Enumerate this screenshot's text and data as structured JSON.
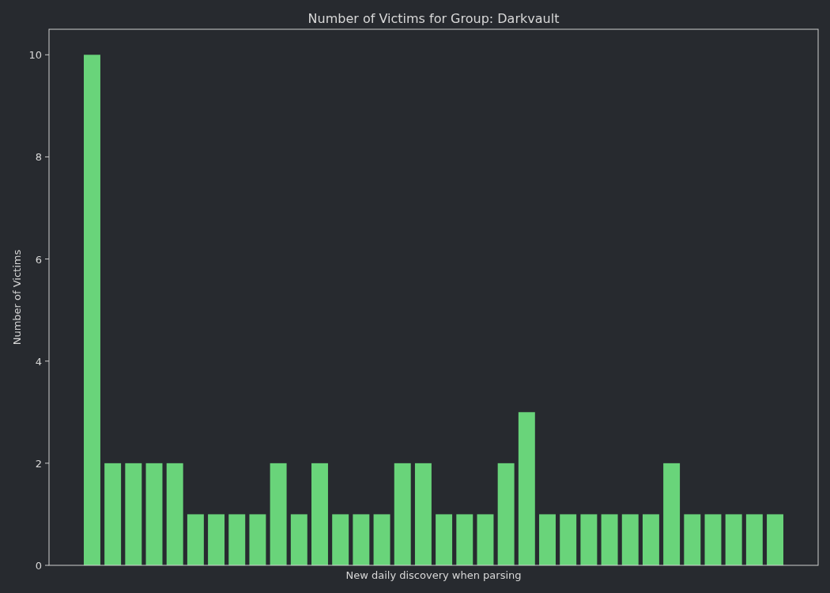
{
  "chart_data": {
    "type": "bar",
    "title": "Number of Victims for Group: Darkvault",
    "xlabel": "New daily discovery when parsing",
    "ylabel": "Number of Victims",
    "series": [
      {
        "color": "#69d47a",
        "values": [
          10,
          2,
          2,
          2,
          2,
          1,
          1,
          1,
          1,
          2,
          1,
          2,
          1,
          1,
          1,
          2,
          2,
          1,
          1,
          1,
          2,
          3,
          1,
          1,
          1,
          1,
          1,
          1,
          2,
          1,
          1,
          1,
          1,
          1
        ]
      }
    ],
    "ylim": [
      0,
      10.5
    ],
    "yticks": [
      0,
      2,
      4,
      6,
      8,
      10
    ]
  }
}
